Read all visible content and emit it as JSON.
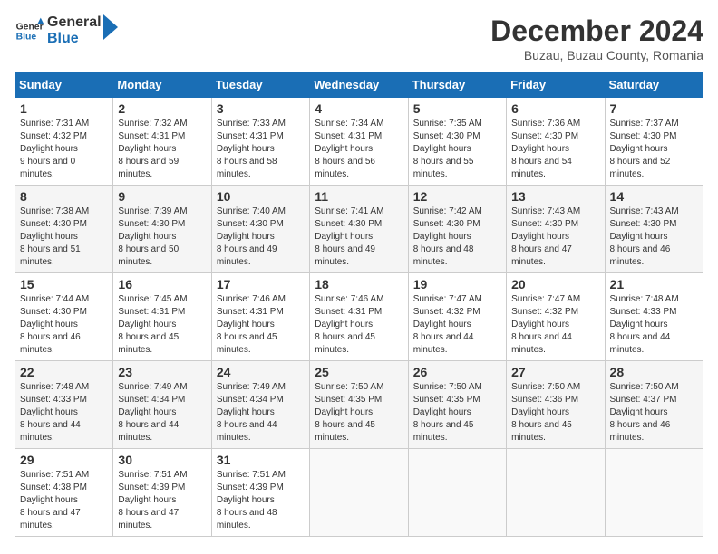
{
  "logo": {
    "text_general": "General",
    "text_blue": "Blue"
  },
  "header": {
    "title": "December 2024",
    "subtitle": "Buzau, Buzau County, Romania"
  },
  "weekdays": [
    "Sunday",
    "Monday",
    "Tuesday",
    "Wednesday",
    "Thursday",
    "Friday",
    "Saturday"
  ],
  "weeks": [
    [
      {
        "day": "1",
        "sunrise": "7:31 AM",
        "sunset": "4:32 PM",
        "daylight": "9 hours and 0 minutes."
      },
      {
        "day": "2",
        "sunrise": "7:32 AM",
        "sunset": "4:31 PM",
        "daylight": "8 hours and 59 minutes."
      },
      {
        "day": "3",
        "sunrise": "7:33 AM",
        "sunset": "4:31 PM",
        "daylight": "8 hours and 58 minutes."
      },
      {
        "day": "4",
        "sunrise": "7:34 AM",
        "sunset": "4:31 PM",
        "daylight": "8 hours and 56 minutes."
      },
      {
        "day": "5",
        "sunrise": "7:35 AM",
        "sunset": "4:30 PM",
        "daylight": "8 hours and 55 minutes."
      },
      {
        "day": "6",
        "sunrise": "7:36 AM",
        "sunset": "4:30 PM",
        "daylight": "8 hours and 54 minutes."
      },
      {
        "day": "7",
        "sunrise": "7:37 AM",
        "sunset": "4:30 PM",
        "daylight": "8 hours and 52 minutes."
      }
    ],
    [
      {
        "day": "8",
        "sunrise": "7:38 AM",
        "sunset": "4:30 PM",
        "daylight": "8 hours and 51 minutes."
      },
      {
        "day": "9",
        "sunrise": "7:39 AM",
        "sunset": "4:30 PM",
        "daylight": "8 hours and 50 minutes."
      },
      {
        "day": "10",
        "sunrise": "7:40 AM",
        "sunset": "4:30 PM",
        "daylight": "8 hours and 49 minutes."
      },
      {
        "day": "11",
        "sunrise": "7:41 AM",
        "sunset": "4:30 PM",
        "daylight": "8 hours and 49 minutes."
      },
      {
        "day": "12",
        "sunrise": "7:42 AM",
        "sunset": "4:30 PM",
        "daylight": "8 hours and 48 minutes."
      },
      {
        "day": "13",
        "sunrise": "7:43 AM",
        "sunset": "4:30 PM",
        "daylight": "8 hours and 47 minutes."
      },
      {
        "day": "14",
        "sunrise": "7:43 AM",
        "sunset": "4:30 PM",
        "daylight": "8 hours and 46 minutes."
      }
    ],
    [
      {
        "day": "15",
        "sunrise": "7:44 AM",
        "sunset": "4:30 PM",
        "daylight": "8 hours and 46 minutes."
      },
      {
        "day": "16",
        "sunrise": "7:45 AM",
        "sunset": "4:31 PM",
        "daylight": "8 hours and 45 minutes."
      },
      {
        "day": "17",
        "sunrise": "7:46 AM",
        "sunset": "4:31 PM",
        "daylight": "8 hours and 45 minutes."
      },
      {
        "day": "18",
        "sunrise": "7:46 AM",
        "sunset": "4:31 PM",
        "daylight": "8 hours and 45 minutes."
      },
      {
        "day": "19",
        "sunrise": "7:47 AM",
        "sunset": "4:32 PM",
        "daylight": "8 hours and 44 minutes."
      },
      {
        "day": "20",
        "sunrise": "7:47 AM",
        "sunset": "4:32 PM",
        "daylight": "8 hours and 44 minutes."
      },
      {
        "day": "21",
        "sunrise": "7:48 AM",
        "sunset": "4:33 PM",
        "daylight": "8 hours and 44 minutes."
      }
    ],
    [
      {
        "day": "22",
        "sunrise": "7:48 AM",
        "sunset": "4:33 PM",
        "daylight": "8 hours and 44 minutes."
      },
      {
        "day": "23",
        "sunrise": "7:49 AM",
        "sunset": "4:34 PM",
        "daylight": "8 hours and 44 minutes."
      },
      {
        "day": "24",
        "sunrise": "7:49 AM",
        "sunset": "4:34 PM",
        "daylight": "8 hours and 44 minutes."
      },
      {
        "day": "25",
        "sunrise": "7:50 AM",
        "sunset": "4:35 PM",
        "daylight": "8 hours and 45 minutes."
      },
      {
        "day": "26",
        "sunrise": "7:50 AM",
        "sunset": "4:35 PM",
        "daylight": "8 hours and 45 minutes."
      },
      {
        "day": "27",
        "sunrise": "7:50 AM",
        "sunset": "4:36 PM",
        "daylight": "8 hours and 45 minutes."
      },
      {
        "day": "28",
        "sunrise": "7:50 AM",
        "sunset": "4:37 PM",
        "daylight": "8 hours and 46 minutes."
      }
    ],
    [
      {
        "day": "29",
        "sunrise": "7:51 AM",
        "sunset": "4:38 PM",
        "daylight": "8 hours and 47 minutes."
      },
      {
        "day": "30",
        "sunrise": "7:51 AM",
        "sunset": "4:39 PM",
        "daylight": "8 hours and 47 minutes."
      },
      {
        "day": "31",
        "sunrise": "7:51 AM",
        "sunset": "4:39 PM",
        "daylight": "8 hours and 48 minutes."
      },
      null,
      null,
      null,
      null
    ]
  ],
  "labels": {
    "sunrise": "Sunrise:",
    "sunset": "Sunset:",
    "daylight": "Daylight hours"
  }
}
